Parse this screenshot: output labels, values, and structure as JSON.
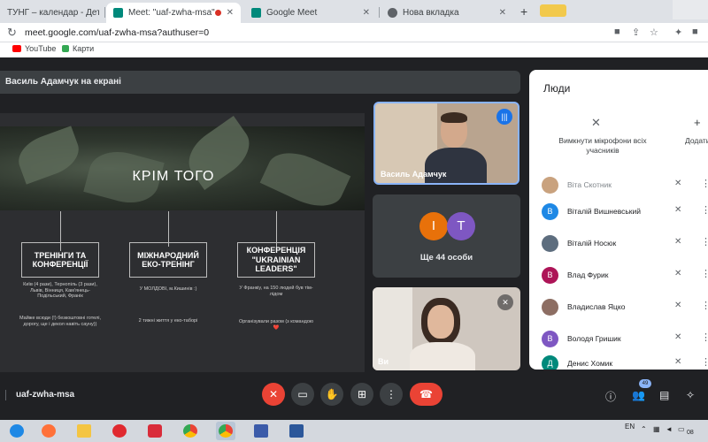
{
  "browser": {
    "tabs": [
      {
        "title": "ТУНГ – календар - Деталі по",
        "active": false,
        "color": "#1a73e8"
      },
      {
        "title": "Meet: \"uaf-zwha-msa\"",
        "active": true,
        "color": "#00897b"
      },
      {
        "title": "Google Meet",
        "active": false,
        "color": "#00897b"
      },
      {
        "title": "Нова вкладка",
        "active": false,
        "color": "#5f6368"
      }
    ],
    "url": "meet.google.com/uaf-zwha-msa?authuser=0",
    "bookmarks": [
      {
        "label": "YouTube",
        "color": "#ff0000"
      },
      {
        "label": "Карти",
        "color": "#34a853"
      }
    ]
  },
  "meet": {
    "presenter_label": "Василь Адамчук на екрані",
    "slide": {
      "title": "КРІМ ТОГО",
      "boxes": [
        {
          "label": "ТРЕНІНГИ ТА КОНФЕРЕНЦІЇ",
          "desc": "Київ (4 рази), Тернопіль (3 рази), Львів, Вінниця, Кам'янець-Подільський, Франік",
          "note": "Майже всюди (!) безкоштовні готелі, дорогу, ще і декол навіть сауну))"
        },
        {
          "label": "МІЖНАРОДНИЙ ЕКО-ТРЕНІНГ",
          "desc": "У МОЛДОВІ, м.Кишинів :)",
          "note": "2 тижні життя у еко-таборі"
        },
        {
          "label": "КОНФЕРЕНЦІЯ \"UKRAINIAN LEADERS\"",
          "desc": "У Франкіу, на 150 людей був тім-лідом",
          "note": "Організували разом (з командою ❤️"
        }
      ]
    },
    "tiles": {
      "speaker_name": "Василь Адамчук",
      "more_label": "Ще 44 особи",
      "avatar_letters": [
        "І",
        "Т"
      ],
      "avatar_colors": [
        "#e8710a",
        "#7e57c2"
      ],
      "third_name": "Ви"
    },
    "people_panel": {
      "title": "Люди",
      "mute_all_label": "Вимкнути мікрофони всіх учасників",
      "add_label": "Додати людей",
      "participants": [
        {
          "name": "Віта Скотник",
          "initial": "",
          "color": "#c9a27e"
        },
        {
          "name": "Віталій Вишневський",
          "initial": "В",
          "color": "#1e88e5"
        },
        {
          "name": "Віталій Носюк",
          "initial": "",
          "color": "#5d6d7e"
        },
        {
          "name": "Влад Фурик",
          "initial": "В",
          "color": "#ad1457"
        },
        {
          "name": "Владислав Яцко",
          "initial": "",
          "color": "#8d6e63"
        },
        {
          "name": "Володя Гришик",
          "initial": "В",
          "color": "#7e57c2"
        },
        {
          "name": "Денис Хомик",
          "initial": "Д",
          "color": "#00897b"
        }
      ]
    },
    "controls": {
      "meeting_code": "uaf-zwha-msa",
      "people_count": "49"
    }
  },
  "taskbar": {
    "lang": "EN",
    "time": "08"
  }
}
